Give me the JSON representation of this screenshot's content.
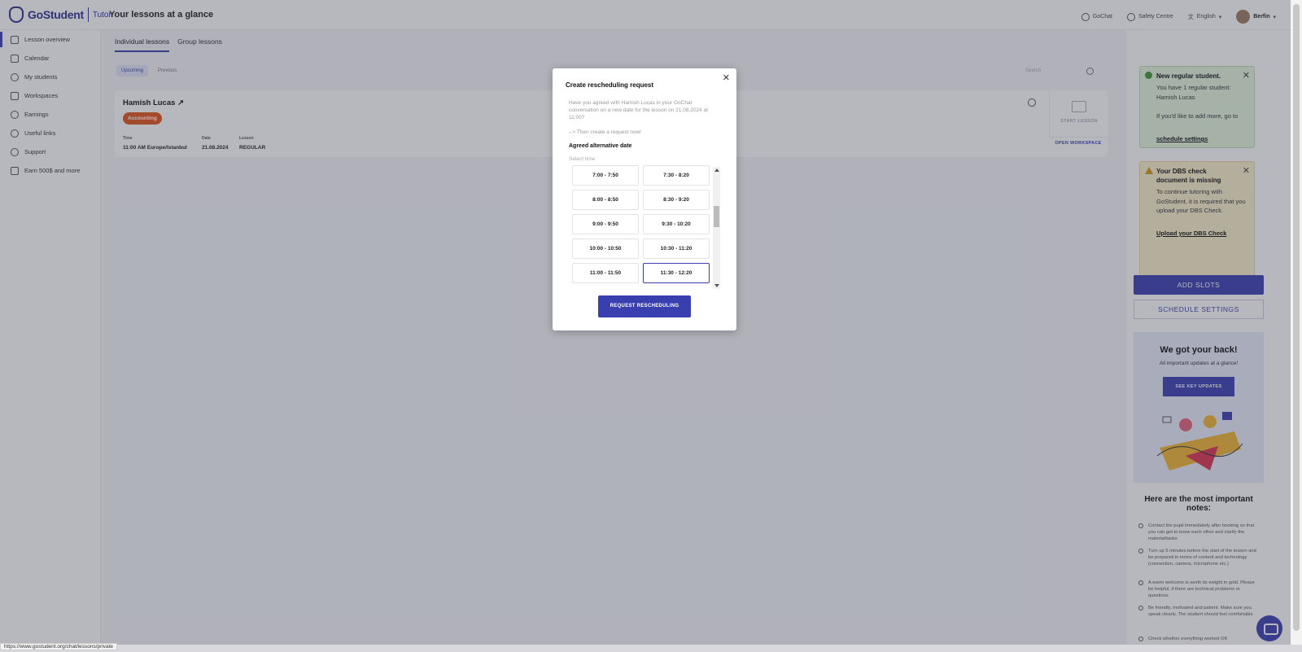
{
  "header": {
    "brand": "GoStudent",
    "brand_sub": "Tutor",
    "page_title": "Your lessons at a glance",
    "gochat": "GoChat",
    "safety": "Safety Centre",
    "language": "English",
    "user": "Berfin"
  },
  "sidebar": {
    "items": [
      {
        "label": "Lesson overview",
        "icon": "lesson-icon",
        "active": true
      },
      {
        "label": "Calendar",
        "icon": "calendar-icon"
      },
      {
        "label": "My students",
        "icon": "students-icon"
      },
      {
        "label": "Workspaces",
        "icon": "workspaces-icon"
      },
      {
        "label": "Earnings",
        "icon": "earnings-icon"
      },
      {
        "label": "Useful links",
        "icon": "link-icon"
      },
      {
        "label": "Support",
        "icon": "support-icon"
      },
      {
        "label": "Earn 500$ and more",
        "icon": "gift-icon"
      }
    ]
  },
  "main": {
    "tabs": [
      "Individual lessons",
      "Group lessons"
    ],
    "filters": [
      "Upcoming",
      "Previous"
    ],
    "search_placeholder": "Search",
    "lesson": {
      "student": "Hamish Lucas",
      "subject": "Accounting",
      "time_label": "Time",
      "time": "11:00 AM Europe/Istanbul",
      "date_label": "Date",
      "date": "21.08.2024",
      "lesson_label": "Lesson",
      "lesson_type": "REGULAR",
      "start": "START LESSON",
      "open_workspace": "OPEN WORKSPACE"
    }
  },
  "right": {
    "notice1": {
      "title": "New regular student.",
      "body_1": "You have 1 regular student: Hamish Lucas",
      "body_2": "If you'd like to add more, go to",
      "link": "schedule settings"
    },
    "notice2": {
      "title": "Your DBS check document is missing",
      "body": "To continue tutoring with GoStudent, it is required that you upload your DBS Check.",
      "link": "Upload your DBS Check"
    },
    "add_slots": "ADD SLOTS",
    "schedule_settings": "SCHEDULE SETTINGS",
    "promo": {
      "title": "We got your back!",
      "sub": "All important updates at a glance!",
      "button": "SEE KEY UPDATES"
    },
    "notes_title": "Here are the most important notes:",
    "notes": [
      "Contact the pupil immediately after booking so that you can get to know each other and clarify the material/tasks",
      "Turn up 5 minutes before the start of the lesson and be prepared in terms of content and technology (connection, camera, microphone etc.)",
      "A warm welcome is worth its weight in gold. Please be helpful, if there are technical problems or questions",
      "Be friendly, motivated and patient. Make sure you speak clearly. The student should feel comfortable",
      "Check whether everything worked OK"
    ]
  },
  "modal": {
    "title": "Create rescheduling request",
    "text": "Have you agreed with Hamish Lucas in your GoChat conversation on a new date for the lesson on 21.08.2024 at 11:00?",
    "hint": "--> Then create a request now!",
    "subtitle": "Agreed alternative date",
    "select_label": "Select time",
    "slots": [
      "7:00 - 7:50",
      "7:30 - 8:20",
      "8:00 - 8:50",
      "8:30 - 9:20",
      "9:00 - 9:50",
      "9:30 - 10:20",
      "10:00 - 10:50",
      "10:30 - 11:20",
      "11:00 - 11:50",
      "11:30 - 12:20"
    ],
    "selected_slot": "11:30 - 12:20",
    "button": "REQUEST RESCHEDULING"
  },
  "status_url": "https://www.gostudent.org/chat/lessons/private"
}
